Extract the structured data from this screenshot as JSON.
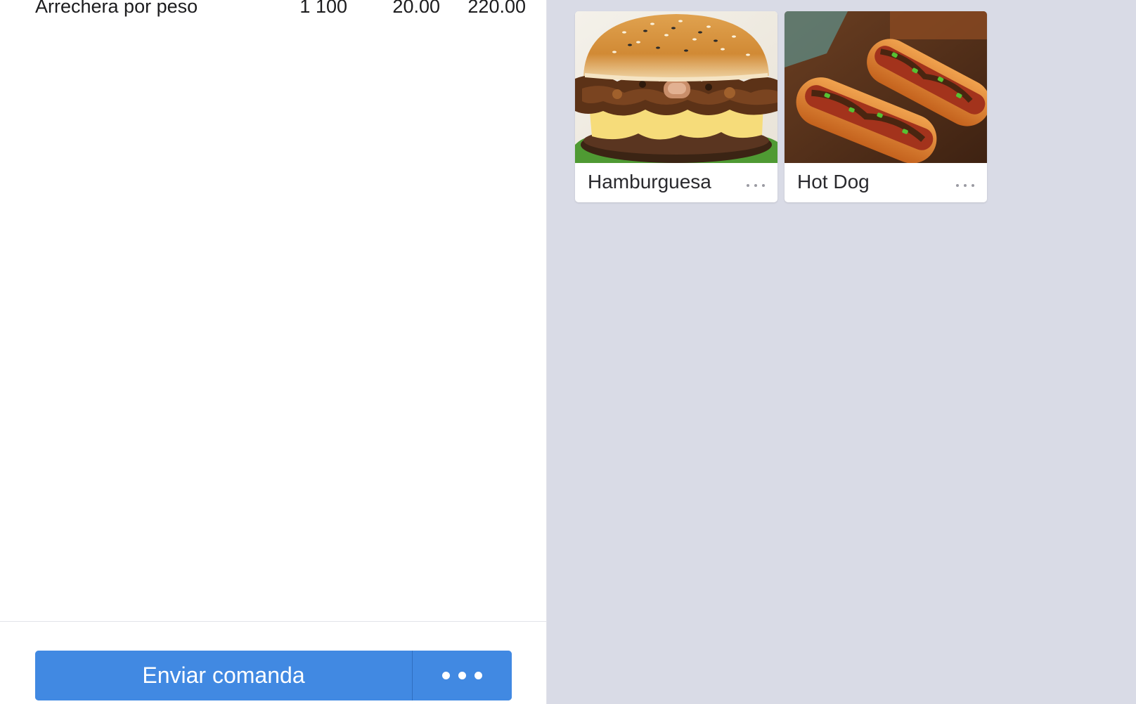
{
  "order": {
    "rows": [
      {
        "name": "Arrechera por peso",
        "qty": "1 100",
        "price": "20.00",
        "total": "220.00"
      }
    ],
    "send_label": "Enviar comanda",
    "more_icon": "ellipsis-icon"
  },
  "products": [
    {
      "name": "Hamburguesa",
      "image": "hamburger-photo",
      "more_icon": "ellipsis-icon"
    },
    {
      "name": "Hot Dog",
      "image": "hot-dog-photo",
      "more_icon": "ellipsis-icon"
    }
  ],
  "colors": {
    "accent": "#4189e2",
    "panel_background": "#d9dbe6",
    "text": "#1c1c1e"
  }
}
